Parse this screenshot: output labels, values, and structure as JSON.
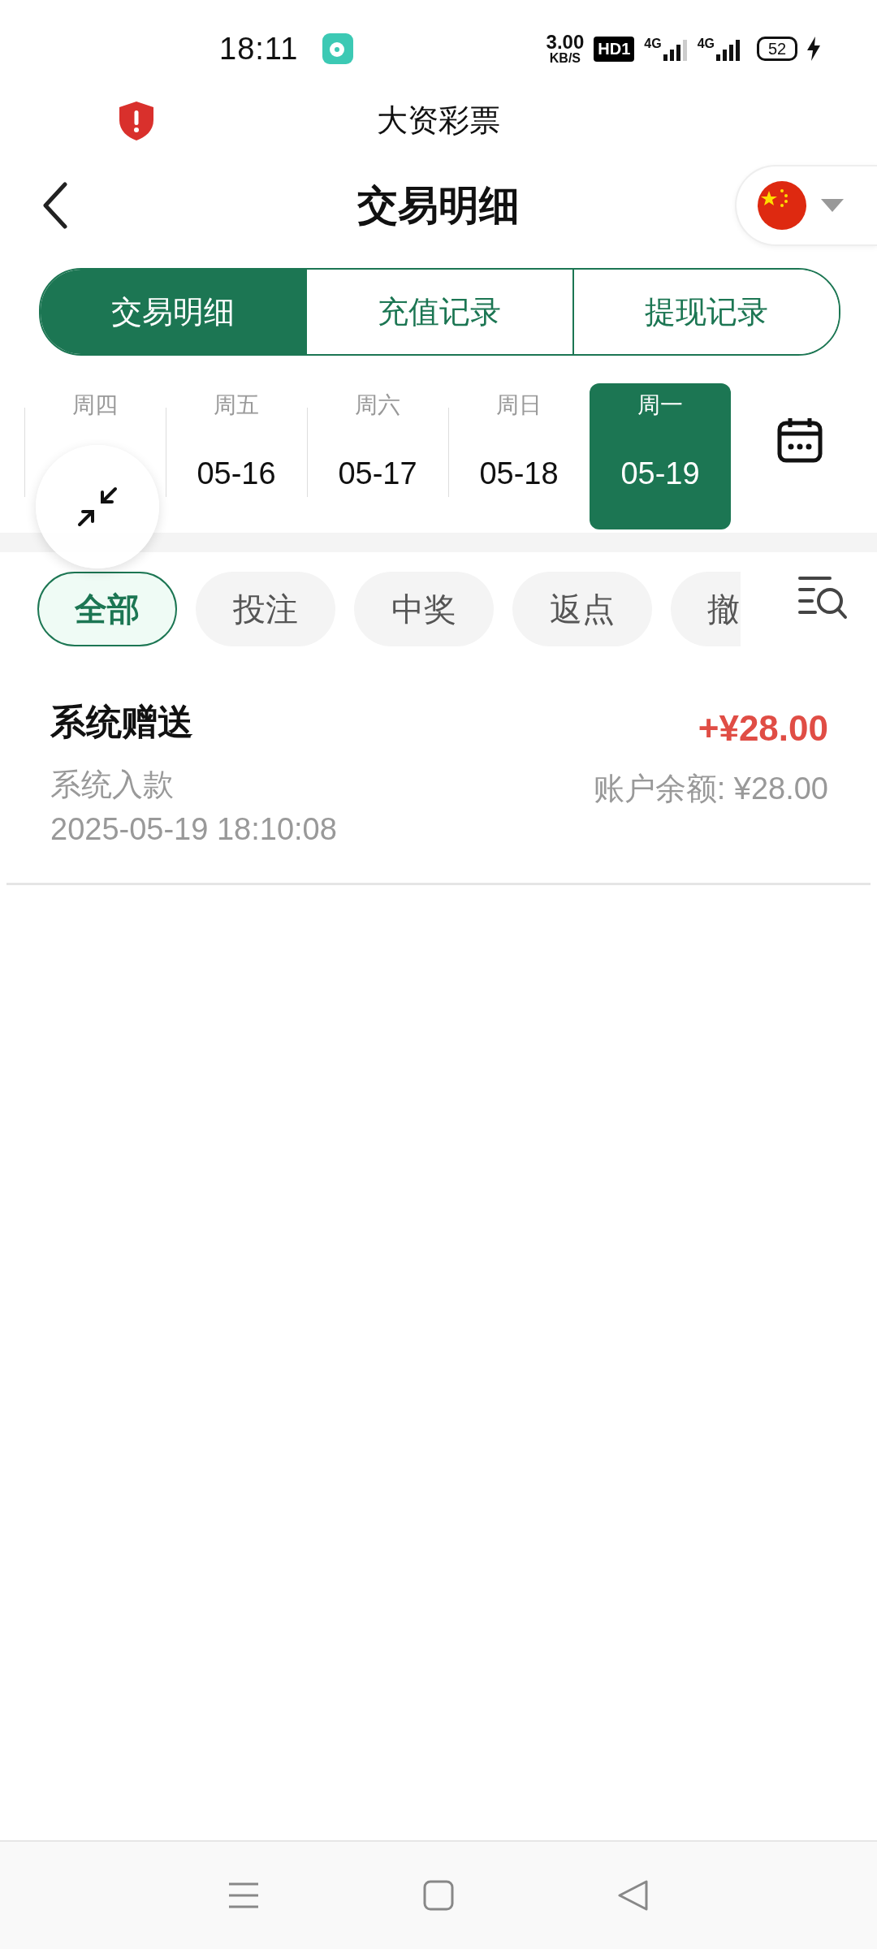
{
  "status_bar": {
    "time": "18:11",
    "speed_value": "3.00",
    "speed_unit": "KB/S",
    "hd_badge": "HD1",
    "sim_1": "4G",
    "sim_2": "4G",
    "battery": "52"
  },
  "app_bar": {
    "title": "大资彩票"
  },
  "header": {
    "title": "交易明细"
  },
  "tabs": [
    {
      "label": "交易明细",
      "selected": true
    },
    {
      "label": "充值记录",
      "selected": false
    },
    {
      "label": "提现记录",
      "selected": false
    }
  ],
  "days": [
    {
      "weekday": "周四",
      "selected": false
    },
    {
      "weekday": "周五",
      "date": "05-16",
      "selected": false
    },
    {
      "weekday": "周六",
      "date": "05-17",
      "selected": false
    },
    {
      "weekday": "周日",
      "date": "05-18",
      "selected": false
    },
    {
      "weekday": "周一",
      "date": "05-19",
      "selected": true
    }
  ],
  "filters": [
    {
      "label": "全部",
      "selected": true
    },
    {
      "label": "投注",
      "selected": false
    },
    {
      "label": "中奖",
      "selected": false
    },
    {
      "label": "返点",
      "selected": false
    },
    {
      "label": "撤",
      "selected": false
    }
  ],
  "records": [
    {
      "title": "系统赠送",
      "subtitle": "系统入款",
      "time": "2025-05-19 18:10:08",
      "amount": "+¥28.00",
      "balance": "账户余额: ¥28.00"
    }
  ]
}
